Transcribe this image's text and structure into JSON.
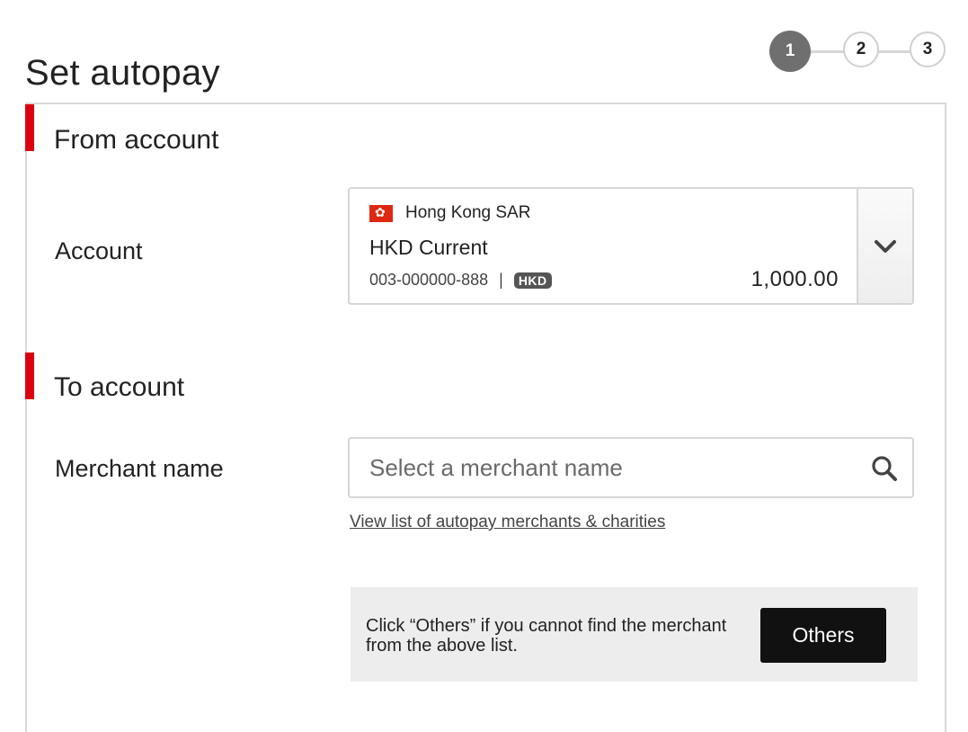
{
  "page": {
    "title": "Set autopay"
  },
  "stepper": {
    "steps": [
      "1",
      "2",
      "3"
    ],
    "active_step": "1"
  },
  "from_section": {
    "title": "From account",
    "account_label": "Account",
    "account": {
      "region": "Hong Kong SAR",
      "name": "HKD Current",
      "number": "003-000000-888",
      "separator": "|",
      "currency": "HKD",
      "balance": "1,000.00"
    },
    "dropdown_icon": "chevron-down-icon"
  },
  "to_section": {
    "title": "To account",
    "merchant_label": "Merchant name",
    "merchant_input": {
      "value": "",
      "placeholder": "Select a merchant name"
    },
    "search_icon": "search-icon",
    "merchant_list_link": "View list of autopay merchants & charities",
    "others_panel": {
      "text": "Click “Others” if you cannot find the merchant from the above list.",
      "button_label": "Others"
    }
  },
  "colors": {
    "accent": "#db0011",
    "step_active": "#6f6f6f",
    "button_dark": "#111111",
    "panel_bg": "#ededed"
  }
}
